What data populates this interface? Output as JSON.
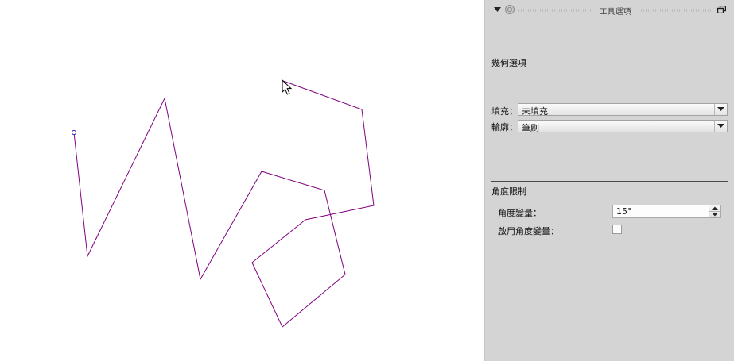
{
  "canvas": {
    "path_color": "#800080",
    "handle_color": "#2b2bb3"
  },
  "panel": {
    "title": "工具選項",
    "geometry_options_label": "幾何選項",
    "fill": {
      "label": "填充：",
      "value": "未填充"
    },
    "outline": {
      "label": "輪廓：",
      "value": "筆刷"
    },
    "angle_constraint": {
      "section_label": "角度限制",
      "delta_label": "角度變量：",
      "delta_value": "15°",
      "enable_label": "啟用角度變量：",
      "enabled": false
    }
  },
  "icons": {
    "collapse": "triangle-down-icon",
    "panel": "circle-badge-icon",
    "detach": "float-window-icon",
    "cursor": "arrow-cursor-icon"
  }
}
